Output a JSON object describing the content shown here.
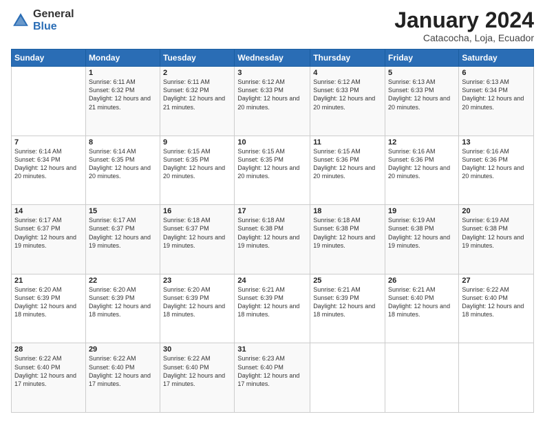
{
  "logo": {
    "general": "General",
    "blue": "Blue"
  },
  "header": {
    "month": "January 2024",
    "location": "Catacocha, Loja, Ecuador"
  },
  "days_of_week": [
    "Sunday",
    "Monday",
    "Tuesday",
    "Wednesday",
    "Thursday",
    "Friday",
    "Saturday"
  ],
  "weeks": [
    [
      {
        "num": "",
        "sunrise": "",
        "sunset": "",
        "daylight": ""
      },
      {
        "num": "1",
        "sunrise": "6:11 AM",
        "sunset": "6:32 PM",
        "daylight": "12 hours and 21 minutes."
      },
      {
        "num": "2",
        "sunrise": "6:11 AM",
        "sunset": "6:32 PM",
        "daylight": "12 hours and 21 minutes."
      },
      {
        "num": "3",
        "sunrise": "6:12 AM",
        "sunset": "6:33 PM",
        "daylight": "12 hours and 20 minutes."
      },
      {
        "num": "4",
        "sunrise": "6:12 AM",
        "sunset": "6:33 PM",
        "daylight": "12 hours and 20 minutes."
      },
      {
        "num": "5",
        "sunrise": "6:13 AM",
        "sunset": "6:33 PM",
        "daylight": "12 hours and 20 minutes."
      },
      {
        "num": "6",
        "sunrise": "6:13 AM",
        "sunset": "6:34 PM",
        "daylight": "12 hours and 20 minutes."
      }
    ],
    [
      {
        "num": "7",
        "sunrise": "6:14 AM",
        "sunset": "6:34 PM",
        "daylight": "12 hours and 20 minutes."
      },
      {
        "num": "8",
        "sunrise": "6:14 AM",
        "sunset": "6:35 PM",
        "daylight": "12 hours and 20 minutes."
      },
      {
        "num": "9",
        "sunrise": "6:15 AM",
        "sunset": "6:35 PM",
        "daylight": "12 hours and 20 minutes."
      },
      {
        "num": "10",
        "sunrise": "6:15 AM",
        "sunset": "6:35 PM",
        "daylight": "12 hours and 20 minutes."
      },
      {
        "num": "11",
        "sunrise": "6:15 AM",
        "sunset": "6:36 PM",
        "daylight": "12 hours and 20 minutes."
      },
      {
        "num": "12",
        "sunrise": "6:16 AM",
        "sunset": "6:36 PM",
        "daylight": "12 hours and 20 minutes."
      },
      {
        "num": "13",
        "sunrise": "6:16 AM",
        "sunset": "6:36 PM",
        "daylight": "12 hours and 20 minutes."
      }
    ],
    [
      {
        "num": "14",
        "sunrise": "6:17 AM",
        "sunset": "6:37 PM",
        "daylight": "12 hours and 19 minutes."
      },
      {
        "num": "15",
        "sunrise": "6:17 AM",
        "sunset": "6:37 PM",
        "daylight": "12 hours and 19 minutes."
      },
      {
        "num": "16",
        "sunrise": "6:18 AM",
        "sunset": "6:37 PM",
        "daylight": "12 hours and 19 minutes."
      },
      {
        "num": "17",
        "sunrise": "6:18 AM",
        "sunset": "6:38 PM",
        "daylight": "12 hours and 19 minutes."
      },
      {
        "num": "18",
        "sunrise": "6:18 AM",
        "sunset": "6:38 PM",
        "daylight": "12 hours and 19 minutes."
      },
      {
        "num": "19",
        "sunrise": "6:19 AM",
        "sunset": "6:38 PM",
        "daylight": "12 hours and 19 minutes."
      },
      {
        "num": "20",
        "sunrise": "6:19 AM",
        "sunset": "6:38 PM",
        "daylight": "12 hours and 19 minutes."
      }
    ],
    [
      {
        "num": "21",
        "sunrise": "6:20 AM",
        "sunset": "6:39 PM",
        "daylight": "12 hours and 18 minutes."
      },
      {
        "num": "22",
        "sunrise": "6:20 AM",
        "sunset": "6:39 PM",
        "daylight": "12 hours and 18 minutes."
      },
      {
        "num": "23",
        "sunrise": "6:20 AM",
        "sunset": "6:39 PM",
        "daylight": "12 hours and 18 minutes."
      },
      {
        "num": "24",
        "sunrise": "6:21 AM",
        "sunset": "6:39 PM",
        "daylight": "12 hours and 18 minutes."
      },
      {
        "num": "25",
        "sunrise": "6:21 AM",
        "sunset": "6:39 PM",
        "daylight": "12 hours and 18 minutes."
      },
      {
        "num": "26",
        "sunrise": "6:21 AM",
        "sunset": "6:40 PM",
        "daylight": "12 hours and 18 minutes."
      },
      {
        "num": "27",
        "sunrise": "6:22 AM",
        "sunset": "6:40 PM",
        "daylight": "12 hours and 18 minutes."
      }
    ],
    [
      {
        "num": "28",
        "sunrise": "6:22 AM",
        "sunset": "6:40 PM",
        "daylight": "12 hours and 17 minutes."
      },
      {
        "num": "29",
        "sunrise": "6:22 AM",
        "sunset": "6:40 PM",
        "daylight": "12 hours and 17 minutes."
      },
      {
        "num": "30",
        "sunrise": "6:22 AM",
        "sunset": "6:40 PM",
        "daylight": "12 hours and 17 minutes."
      },
      {
        "num": "31",
        "sunrise": "6:23 AM",
        "sunset": "6:40 PM",
        "daylight": "12 hours and 17 minutes."
      },
      {
        "num": "",
        "sunrise": "",
        "sunset": "",
        "daylight": ""
      },
      {
        "num": "",
        "sunrise": "",
        "sunset": "",
        "daylight": ""
      },
      {
        "num": "",
        "sunrise": "",
        "sunset": "",
        "daylight": ""
      }
    ]
  ]
}
